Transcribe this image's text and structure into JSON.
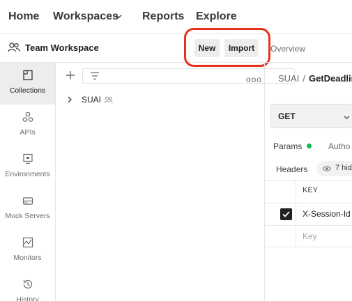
{
  "topnav": {
    "home": "Home",
    "workspaces": "Workspaces",
    "reports": "Reports",
    "explore": "Explore"
  },
  "workspace": {
    "title": "Team Workspace",
    "new_label": "New",
    "import_label": "Import"
  },
  "sidebar": {
    "items": [
      {
        "label": "Collections",
        "icon": "collections-icon",
        "active": true
      },
      {
        "label": "APIs",
        "icon": "apis-icon"
      },
      {
        "label": "Environments",
        "icon": "environments-icon"
      },
      {
        "label": "Mock Servers",
        "icon": "mock-servers-icon"
      },
      {
        "label": "Monitors",
        "icon": "monitors-icon"
      },
      {
        "label": "History",
        "icon": "history-icon"
      }
    ]
  },
  "panel": {
    "more": "ooo",
    "tree": [
      {
        "label": "SUAI",
        "icon": "team-icon"
      }
    ]
  },
  "request": {
    "overview_tab": "Overview",
    "breadcrumb_ws": "SUAI",
    "breadcrumb_sep": "/",
    "breadcrumb_req": "GetDeadlin",
    "method": "GET",
    "params_tab": "Params",
    "auth_tab": "Autho",
    "headers_label": "Headers",
    "hidden_count": "7 hid",
    "key_header": "KEY",
    "header_key": "X-Session-Id",
    "key_placeholder": "Key"
  },
  "colors": {
    "highlight": "#e8311c",
    "params_dot": "#0cbb52",
    "active_rail": "#ededed"
  }
}
